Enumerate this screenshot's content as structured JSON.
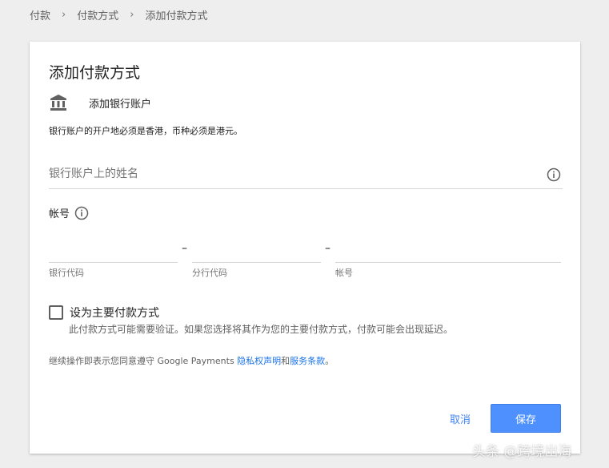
{
  "breadcrumb": [
    "付款",
    "付款方式",
    "添加付款方式"
  ],
  "card": {
    "title": "添加付款方式",
    "bank_label": "添加银行账户",
    "note": "银行账户的开户地必须是香港，币种必须是港元。",
    "name_placeholder": "银行账户上的姓名",
    "account_label": "帐号",
    "fields": [
      {
        "caption": "银行代码",
        "value": ""
      },
      {
        "caption": "分行代码",
        "value": ""
      },
      {
        "caption": "帐号",
        "value": ""
      }
    ],
    "dash": "–",
    "checkbox_label": "设为主要付款方式",
    "checkbox_checked": false,
    "checkbox_note": "此付款方式可能需要验证。如果您选择将其作为您的主要付款方式，付款可能会出现延迟。",
    "terms_prefix": "继续操作即表示您同意遵守 Google Payments ",
    "privacy_link": "隐私权声明",
    "terms_and": "和",
    "terms_link": "服务条款",
    "terms_suffix": "。",
    "cancel_label": "取消",
    "save_label": "保存"
  },
  "icons": {
    "bank": "bank-icon",
    "info": "info-icon"
  },
  "colors": {
    "accent": "#4285f4",
    "save_button": "#4d90fe",
    "link": "#1a73e8"
  },
  "watermark": "头条 @跨境出海"
}
